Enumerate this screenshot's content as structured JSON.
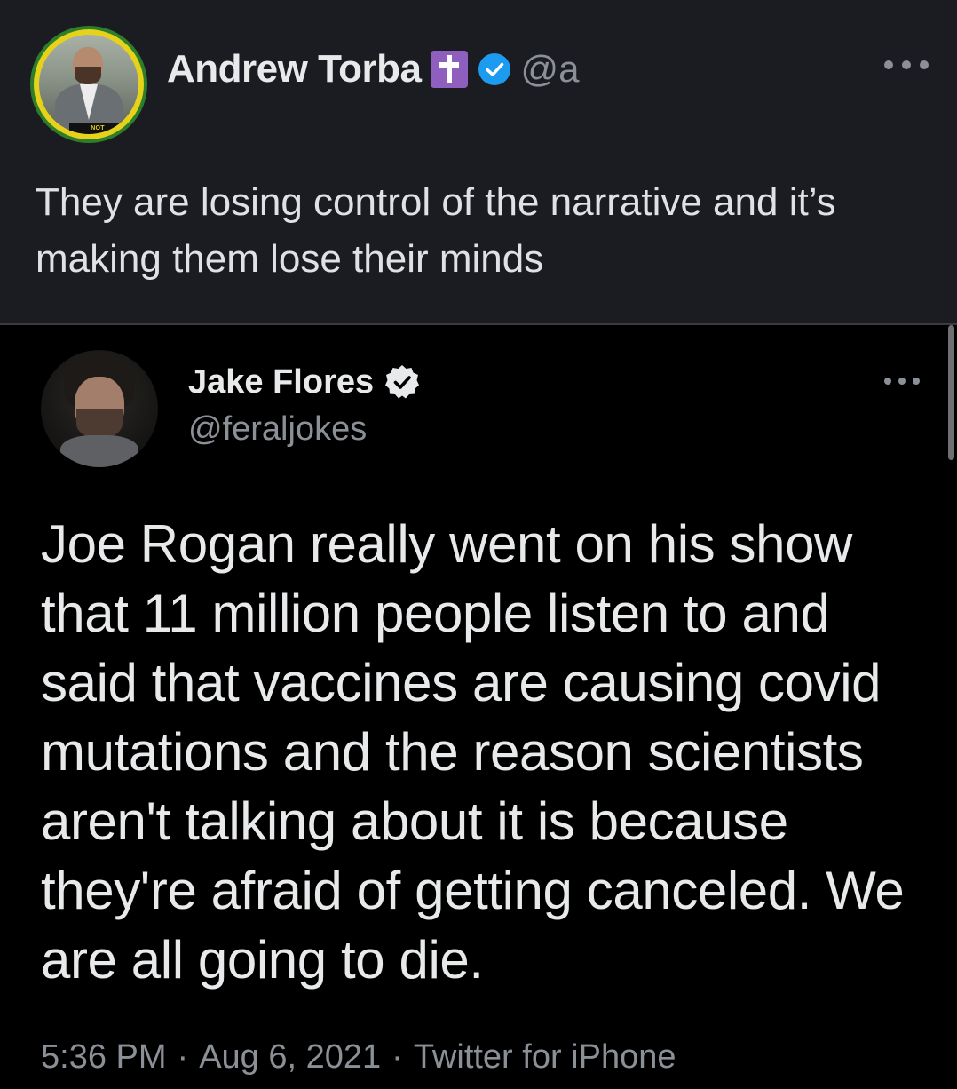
{
  "top_post": {
    "author_name": "Andrew Torba",
    "handle": "@a",
    "avatar_badge": "NOT VACCINATED",
    "text": "They are losing control of the narrative and it’s making them lose their minds"
  },
  "quoted_tweet": {
    "author_name": "Jake Flores",
    "handle": "@feraljokes",
    "text": "Joe Rogan really went on his show that 11 million people listen to and said that vaccines are causing covid mutations and the reason scientists aren't talking about it is because they're afraid of getting canceled. We are all going to die.",
    "time": "5:36 PM",
    "date": "Aug 6, 2021",
    "source": "Twitter for iPhone",
    "separator": "·"
  },
  "colors": {
    "top_background": "#1b1c21",
    "quote_background": "#000000",
    "verified_blue": "#1d9bf0",
    "cross_badge": "#8f5fc0",
    "avatar_ring_yellow": "#e6d21a",
    "avatar_ring_green": "#2e7d2b"
  },
  "icons": {
    "cross": "latin-cross-icon",
    "verified": "verified-check-icon",
    "more": "more-horizontal-icon"
  }
}
